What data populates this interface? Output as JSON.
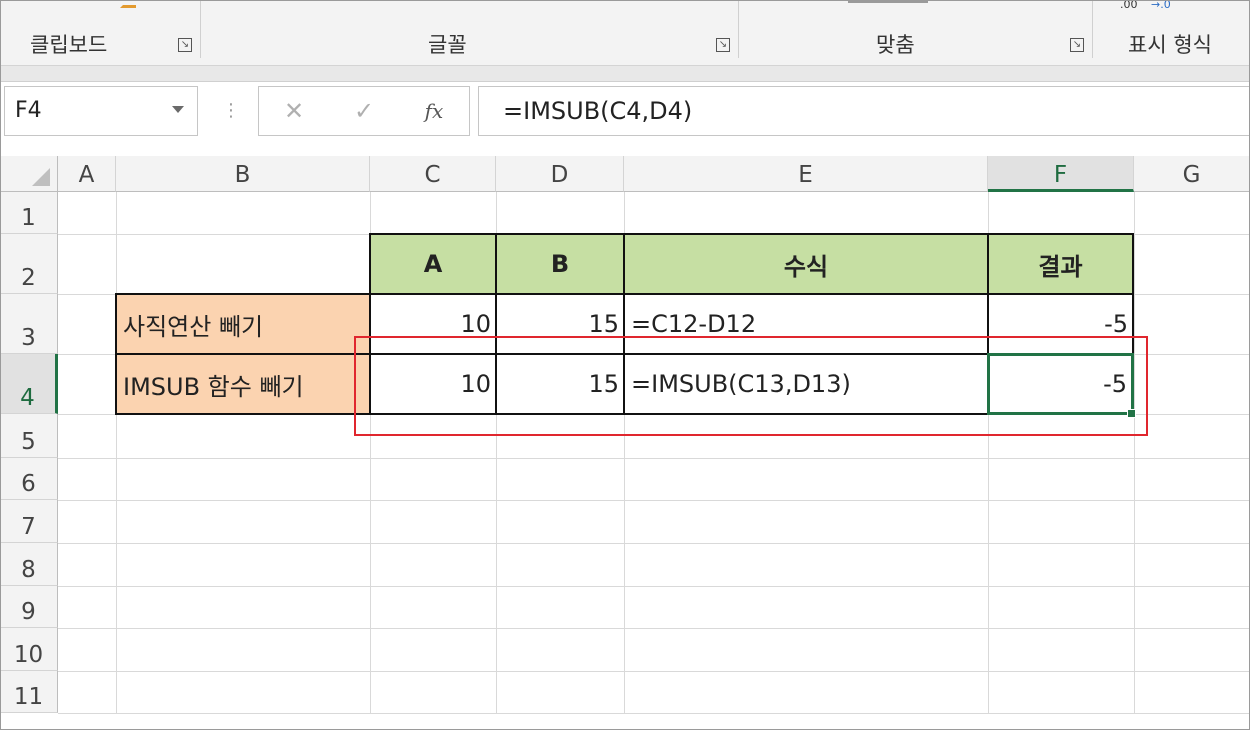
{
  "ribbon": {
    "groups": [
      "클립보드",
      "글꼴",
      "맞춤",
      "표시 형식"
    ],
    "partial_glyph": ".00"
  },
  "formula_bar": {
    "name_box": "F4",
    "cancel_symbol": "✕",
    "enter_symbol": "✓",
    "fx_symbol": "fx",
    "formula": "=IMSUB(C4,D4)"
  },
  "columns": [
    "A",
    "B",
    "C",
    "D",
    "E",
    "F",
    "G"
  ],
  "selected_column": "F",
  "rows": [
    "1",
    "2",
    "3",
    "4",
    "5",
    "6",
    "7",
    "8",
    "9",
    "10",
    "11"
  ],
  "selected_row": "4",
  "table": {
    "headers": {
      "c": "A",
      "d": "B",
      "e": "수식",
      "f": "결과"
    },
    "row3": {
      "b": "사직연산 빼기",
      "c": "10",
      "d": "15",
      "e": "=C12-D12",
      "f": "-5"
    },
    "row4": {
      "b": "IMSUB 함수 빼기",
      "c": "10",
      "d": "15",
      "e": "=IMSUB(C13,D13)",
      "f": "-5"
    }
  },
  "colors": {
    "header_fill": "#c6dfa3",
    "label_fill": "#fbd3b0",
    "selection": "#217346",
    "highlight_box": "#e0262e"
  }
}
